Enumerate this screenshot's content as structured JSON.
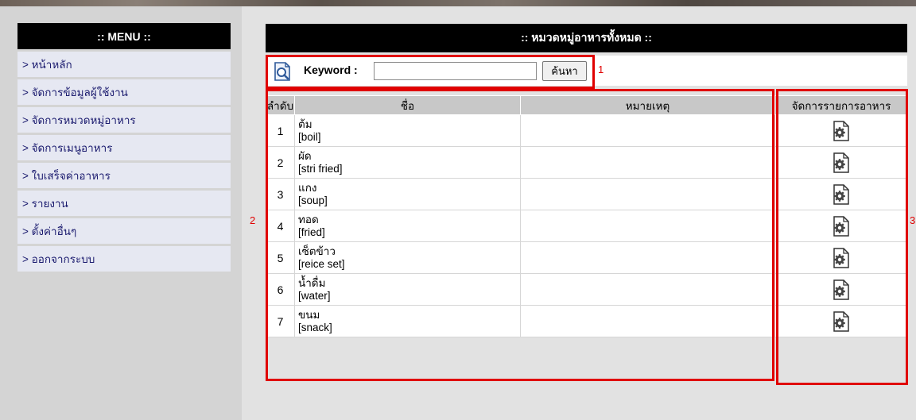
{
  "menu": {
    "title": ":: MENU ::",
    "items": [
      {
        "label": "> หน้าหลัก"
      },
      {
        "label": "> จัดการข้อมูลผู้ใช้งาน"
      },
      {
        "label": "> จัดการหมวดหมู่อาหาร"
      },
      {
        "label": "> จัดการเมนูอาหาร"
      },
      {
        "label": "> ใบเสร็จค่าอาหาร"
      },
      {
        "label": "> รายงาน"
      },
      {
        "label": "> ตั้งค่าอื่นๆ"
      },
      {
        "label": "> ออกจากระบบ"
      }
    ]
  },
  "main": {
    "title": ":: หมวดหมู่อาหารทั้งหมด ::",
    "search": {
      "icon": "search-icon",
      "label": "Keyword :",
      "value": "",
      "button": "ค้นหา"
    },
    "table": {
      "headers": {
        "order": "ลำดับ",
        "name": "ชื่อ",
        "note": "หมายเหตุ",
        "manage": "จัดการรายการอาหาร"
      },
      "rows": [
        {
          "order": "1",
          "name_th": "ต้ม",
          "name_en": "[boil]",
          "note": ""
        },
        {
          "order": "2",
          "name_th": "ผัด",
          "name_en": "[stri fried]",
          "note": ""
        },
        {
          "order": "3",
          "name_th": "แกง",
          "name_en": "[soup]",
          "note": ""
        },
        {
          "order": "4",
          "name_th": "ทอด",
          "name_en": "[fried]",
          "note": ""
        },
        {
          "order": "5",
          "name_th": "เซ็ตข้าว",
          "name_en": "[reice set]",
          "note": ""
        },
        {
          "order": "6",
          "name_th": "น้ำดื่ม",
          "name_en": "[water]",
          "note": ""
        },
        {
          "order": "7",
          "name_th": "ขนม",
          "name_en": "[snack]",
          "note": ""
        }
      ]
    }
  },
  "annotations": {
    "one": "1",
    "two": "2",
    "three": "3",
    "color": "#e00000"
  }
}
